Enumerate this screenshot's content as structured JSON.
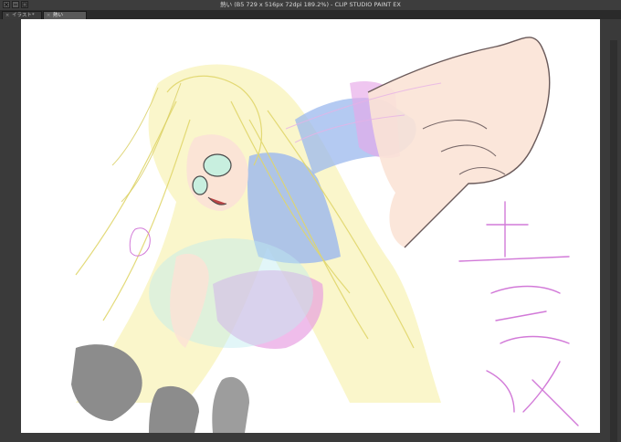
{
  "window": {
    "title": "熱い (B5 729 x 516px 72dpi 189.2%)  - CLIP STUDIO PAINT EX"
  },
  "tabs": [
    {
      "label": "イラスト*",
      "active": false
    },
    {
      "label": "熱い",
      "active": true
    }
  ],
  "colors": {
    "hair": "#f0e97a",
    "shirt": "#9bb8ee",
    "sleeve": "#e7a8e8",
    "shorts": "#e69ae0",
    "skin": "#fbe3d6",
    "shoe": "#8c8c8c",
    "rough_lines": "#d27ad8"
  }
}
